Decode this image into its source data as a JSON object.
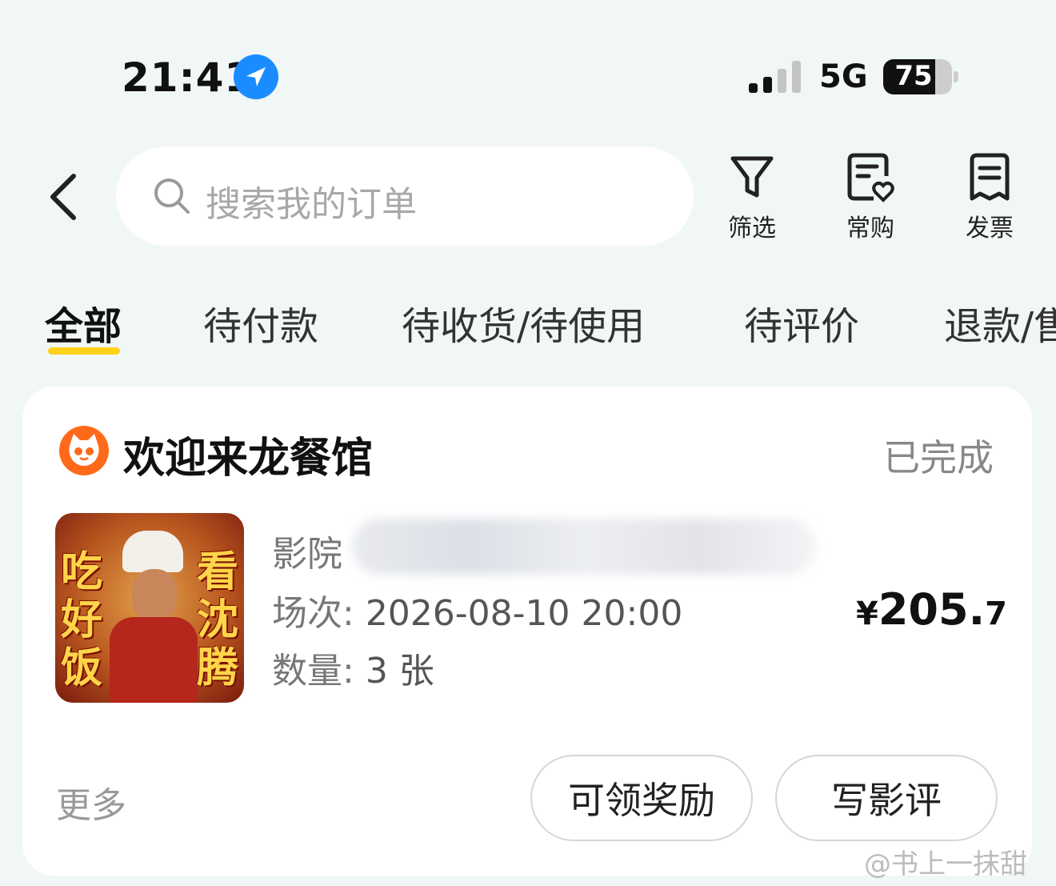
{
  "status_bar": {
    "time": "21:41",
    "network": "5G",
    "battery": "75",
    "battery_level": 0.75
  },
  "header": {
    "search_placeholder": "搜索我的订单",
    "actions": [
      {
        "label": "筛选",
        "icon": "filter-icon"
      },
      {
        "label": "常购",
        "icon": "favorite-list-icon"
      },
      {
        "label": "发票",
        "icon": "invoice-icon"
      }
    ]
  },
  "tabs": [
    {
      "label": "全部",
      "active": true
    },
    {
      "label": "待付款"
    },
    {
      "label": "待收货/待使用"
    },
    {
      "label": "待评价"
    },
    {
      "label": "退款/售"
    }
  ],
  "order": {
    "shop_name": "欢迎来龙餐馆",
    "status": "已完成",
    "poster_text_left": "吃好饭",
    "poster_text_right": "看沈腾",
    "cinema_label": "影院",
    "session_label": "场次: ",
    "session_value": "2026-08-10 20:00",
    "quantity_label": "数量: ",
    "quantity_value": "3 张",
    "price_symbol": "¥",
    "price_int": "205.",
    "price_dec": "7",
    "more": "更多",
    "buttons": {
      "reward": "可领奖励",
      "review": "写影评"
    }
  },
  "watermark": "@书上一抹甜",
  "colors": {
    "background": "#f1f6f7",
    "tab_underline": "#ffd21a",
    "location_icon": "#1a8cff",
    "brand_logo": "#ff6a1a"
  }
}
